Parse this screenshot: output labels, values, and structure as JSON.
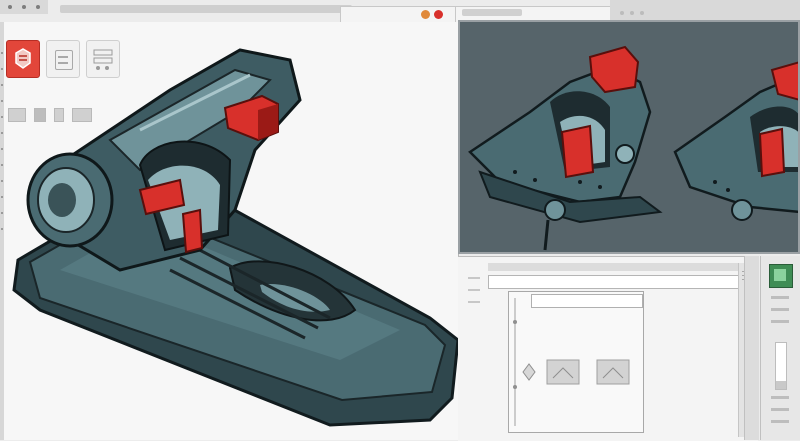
{
  "colors": {
    "accent_red": "#d8302b",
    "model_body": "#4a6b72",
    "model_highlight": "#8fb2b8",
    "model_dark": "#243438",
    "viewport_bg": "#56646a",
    "panel_bg": "#f7f7f7",
    "chrome": "#d9d9d9",
    "swatch_green": "#3f8d55"
  },
  "window_buttons": [
    {
      "icon": "minimize-icon",
      "color": "#e0893a"
    },
    {
      "icon": "close-icon",
      "color": "#d8302b"
    }
  ],
  "toolbar": {
    "tools": [
      {
        "icon": "part-tool-icon",
        "active": true
      },
      {
        "icon": "sketch-tool-icon",
        "active": false
      },
      {
        "icon": "feature-tool-icon",
        "active": false
      }
    ]
  },
  "viewport": {
    "models": [
      {
        "icon": "clamp-model-front-icon"
      },
      {
        "icon": "clamp-model-side-icon"
      }
    ]
  },
  "properties": {
    "slider_level": 0.18
  }
}
